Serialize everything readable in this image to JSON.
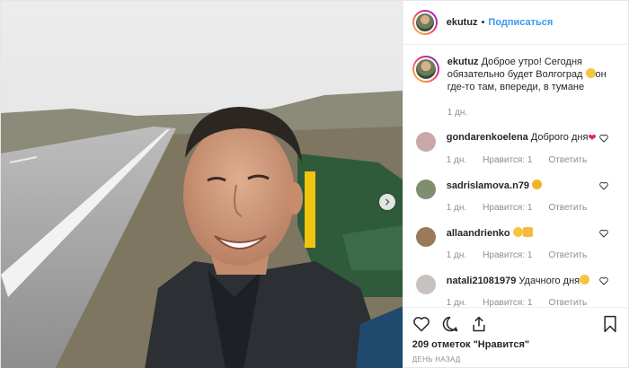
{
  "header": {
    "username": "ekutuz",
    "separator": "•",
    "follow_label": "Подписаться"
  },
  "caption": {
    "username": "ekutuz",
    "text": "Доброе утро! Сегодня обязательно будет Волгоград",
    "text_after_emoji": "он где-то там, впереди, в тумане",
    "time": "1 дн."
  },
  "comments": [
    {
      "username": "gondarenkoelena",
      "text": "Доброго дня",
      "emoji": "red-heart",
      "time": "1 дн.",
      "like_label": "Нравится: 1",
      "reply_label": "Ответить",
      "avatar_color": "#c9a9a6"
    },
    {
      "username": "sadrislamova.n79",
      "text": "",
      "emoji": "crying-face",
      "time": "1 дн.",
      "like_label": "Нравится: 1",
      "reply_label": "Ответить",
      "avatar_color": "#7d8f6e"
    },
    {
      "username": "allaandrienko",
      "text": "",
      "emoji": "smile-thumbs-up",
      "time": "1 дн.",
      "like_label": "Нравится: 1",
      "reply_label": "Ответить",
      "avatar_color": "#9b7a5c"
    },
    {
      "username": "natali21081979",
      "text": "Удачного дня",
      "emoji": "smile",
      "time": "1 дн.",
      "like_label": "Нравится: 1",
      "reply_label": "Ответить",
      "avatar_color": "#c7c2bf"
    }
  ],
  "likes_text": "209 отметок \"Нравится\"",
  "posted_ago": "ДЕНЬ НАЗАД",
  "icons": {
    "like": "heart-outline-icon",
    "comment": "comment-bubble-icon",
    "share": "share-arrow-icon",
    "save": "bookmark-icon",
    "next": "chevron-right-icon"
  },
  "colors": {
    "link": "#3897f0",
    "text": "#262626",
    "secondary": "#8e8e8e",
    "heart": "#e0245e"
  }
}
